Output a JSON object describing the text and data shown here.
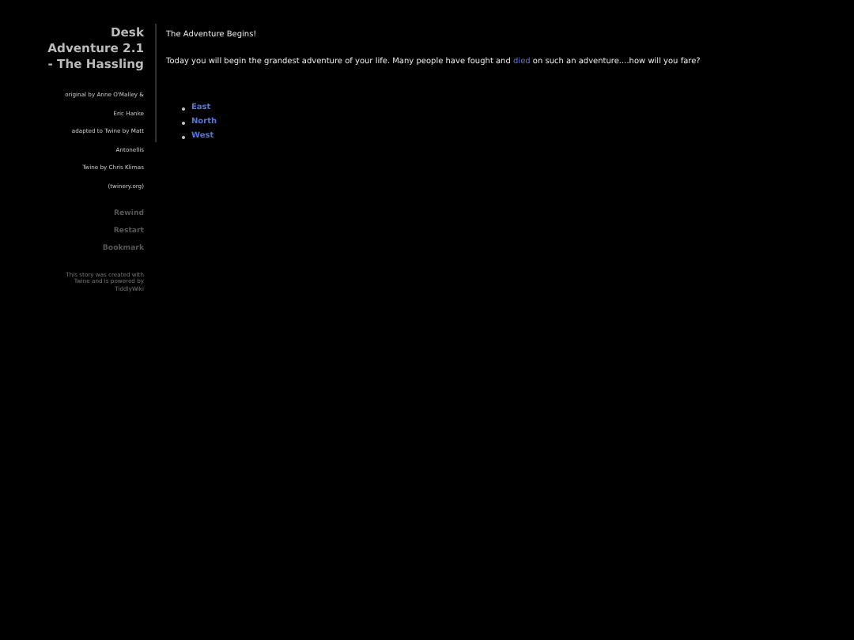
{
  "sidebar": {
    "title": "Desk Adventure 2.1 - The Hassling",
    "credits": [
      "original by Anne O'Malley &",
      "Eric Hanke",
      "adapted to Twine by Matt",
      "Antonellis",
      "Twine by Chris Klimas",
      "(twinery.org)"
    ],
    "menu": [
      "Rewind",
      "Restart",
      "Bookmark"
    ],
    "footer": "This story was created with Twine and is powered by TiddlyWiki"
  },
  "passage": {
    "title": "The Adventure Begins!",
    "text_before": "Today you will begin the grandest adventure of your life. Many people have fought and ",
    "link": "died",
    "text_after": " on such an adventure....how will you fare?",
    "choices": [
      "East",
      "North",
      "West"
    ]
  }
}
